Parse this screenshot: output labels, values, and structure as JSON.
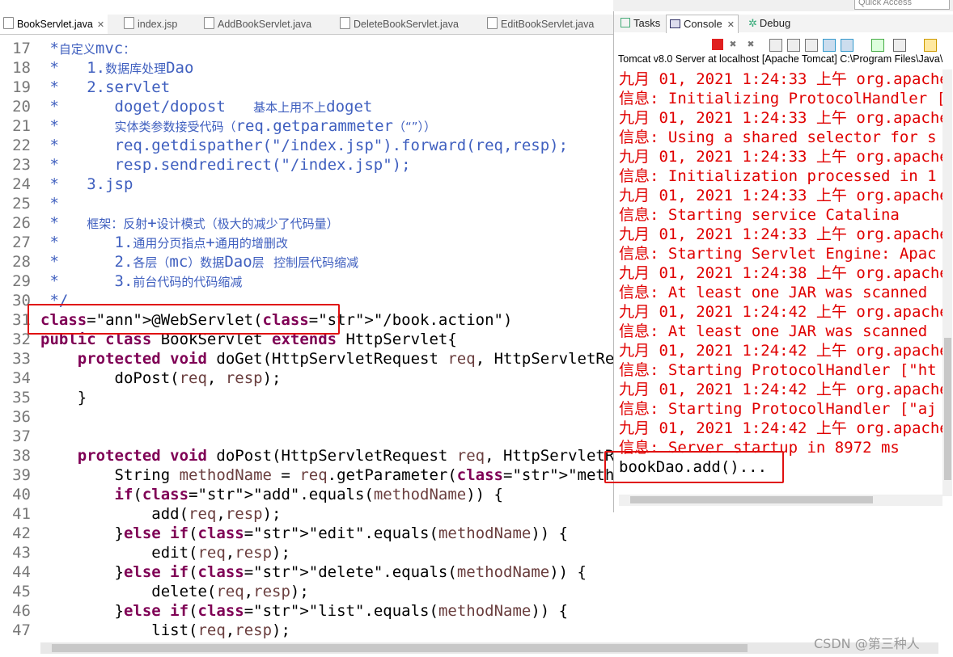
{
  "quick_access": "Quick Access",
  "editor": {
    "tabs": [
      "BookServlet.java",
      "index.jsp",
      "AddBookServlet.java",
      "DeleteBookServlet.java",
      "EditBookServlet.java"
    ],
    "lines": [
      {
        "n": "17",
        "t": " *自定义mvc："
      },
      {
        "n": "18",
        "t": " *   1.数据库处理Dao"
      },
      {
        "n": "19",
        "t": " *   2.servlet"
      },
      {
        "n": "20",
        "t": " *      doget/dopost   基本上用不上doget"
      },
      {
        "n": "21",
        "t": " *      实体类参数接受代码（req.getparammeter（“”））"
      },
      {
        "n": "22",
        "t": " *      req.getdispather(\"/index.jsp\").forward(req,resp);"
      },
      {
        "n": "23",
        "t": " *      resp.sendredirect(\"/index.jsp\");"
      },
      {
        "n": "24",
        "t": " *   3.jsp"
      },
      {
        "n": "25",
        "t": " *"
      },
      {
        "n": "26",
        "t": " *   框架：反射+设计模式（极大的减少了代码量）"
      },
      {
        "n": "27",
        "t": " *      1.通用分页指点+通用的增删改"
      },
      {
        "n": "28",
        "t": " *      2.各层（mc）数据Dao层 控制层代码缩减"
      },
      {
        "n": "29",
        "t": " *      3.前台代码的代码缩减"
      },
      {
        "n": "30",
        "t": " */"
      },
      {
        "n": "31",
        "t": "@WebServlet(\"/book.action\")"
      },
      {
        "n": "32",
        "t": "public class BookServlet extends HttpServlet{"
      },
      {
        "n": "33",
        "t": "    protected void doGet(HttpServletRequest req, HttpServletResponse resp)"
      },
      {
        "n": "34",
        "t": "        doPost(req, resp);"
      },
      {
        "n": "35",
        "t": "    }"
      },
      {
        "n": "36",
        "t": ""
      },
      {
        "n": "37",
        "t": ""
      },
      {
        "n": "38",
        "t": "    protected void doPost(HttpServletRequest req, HttpServletResponse resp)"
      },
      {
        "n": "39",
        "t": "        String methodName = req.getParameter(\"methodName\");"
      },
      {
        "n": "40",
        "t": "        if(\"add\".equals(methodName)) {"
      },
      {
        "n": "41",
        "t": "            add(req,resp);"
      },
      {
        "n": "42",
        "t": "        }else if(\"edit\".equals(methodName)) {"
      },
      {
        "n": "43",
        "t": "            edit(req,resp);"
      },
      {
        "n": "44",
        "t": "        }else if(\"delete\".equals(methodName)) {"
      },
      {
        "n": "45",
        "t": "            delete(req,resp);"
      },
      {
        "n": "46",
        "t": "        }else if(\"list\".equals(methodName)) {"
      },
      {
        "n": "47",
        "t": "            list(req,resp);"
      }
    ]
  },
  "console": {
    "tabs": [
      "Tasks",
      "Console",
      "Debug"
    ],
    "description": "Tomcat v8.0 Server at localhost [Apache Tomcat] C:\\Program Files\\Java\\",
    "lines": [
      {
        "t": "九月 01, 2021 1:24:33 上午 org.apache",
        "c": "red"
      },
      {
        "t": "信息: Initializing ProtocolHandler [",
        "c": "red"
      },
      {
        "t": "九月 01, 2021 1:24:33 上午 org.apache",
        "c": "red"
      },
      {
        "t": "信息: Using a shared selector for s",
        "c": "red"
      },
      {
        "t": "九月 01, 2021 1:24:33 上午 org.apache",
        "c": "red"
      },
      {
        "t": "信息: Initialization processed in 1",
        "c": "red"
      },
      {
        "t": "九月 01, 2021 1:24:33 上午 org.apache",
        "c": "red"
      },
      {
        "t": "信息: Starting service Catalina",
        "c": "red"
      },
      {
        "t": "九月 01, 2021 1:24:33 上午 org.apache",
        "c": "red"
      },
      {
        "t": "信息: Starting Servlet Engine: Apac",
        "c": "red"
      },
      {
        "t": "九月 01, 2021 1:24:38 上午 org.apache",
        "c": "red"
      },
      {
        "t": "信息: At least one JAR was scanned",
        "c": "red"
      },
      {
        "t": "九月 01, 2021 1:24:42 上午 org.apache",
        "c": "red"
      },
      {
        "t": "信息: At least one JAR was scanned",
        "c": "red"
      },
      {
        "t": "九月 01, 2021 1:24:42 上午 org.apache",
        "c": "red"
      },
      {
        "t": "信息: Starting ProtocolHandler [\"ht",
        "c": "red"
      },
      {
        "t": "九月 01, 2021 1:24:42 上午 org.apache",
        "c": "red"
      },
      {
        "t": "信息: Starting ProtocolHandler [\"aj",
        "c": "red"
      },
      {
        "t": "九月 01, 2021 1:24:42 上午 org.apache",
        "c": "red"
      },
      {
        "t": "信息: Server startup in 8972 ms",
        "c": "red"
      },
      {
        "t": "bookDao.add()...",
        "c": "black"
      }
    ]
  },
  "watermark": "CSDN @第三种人"
}
